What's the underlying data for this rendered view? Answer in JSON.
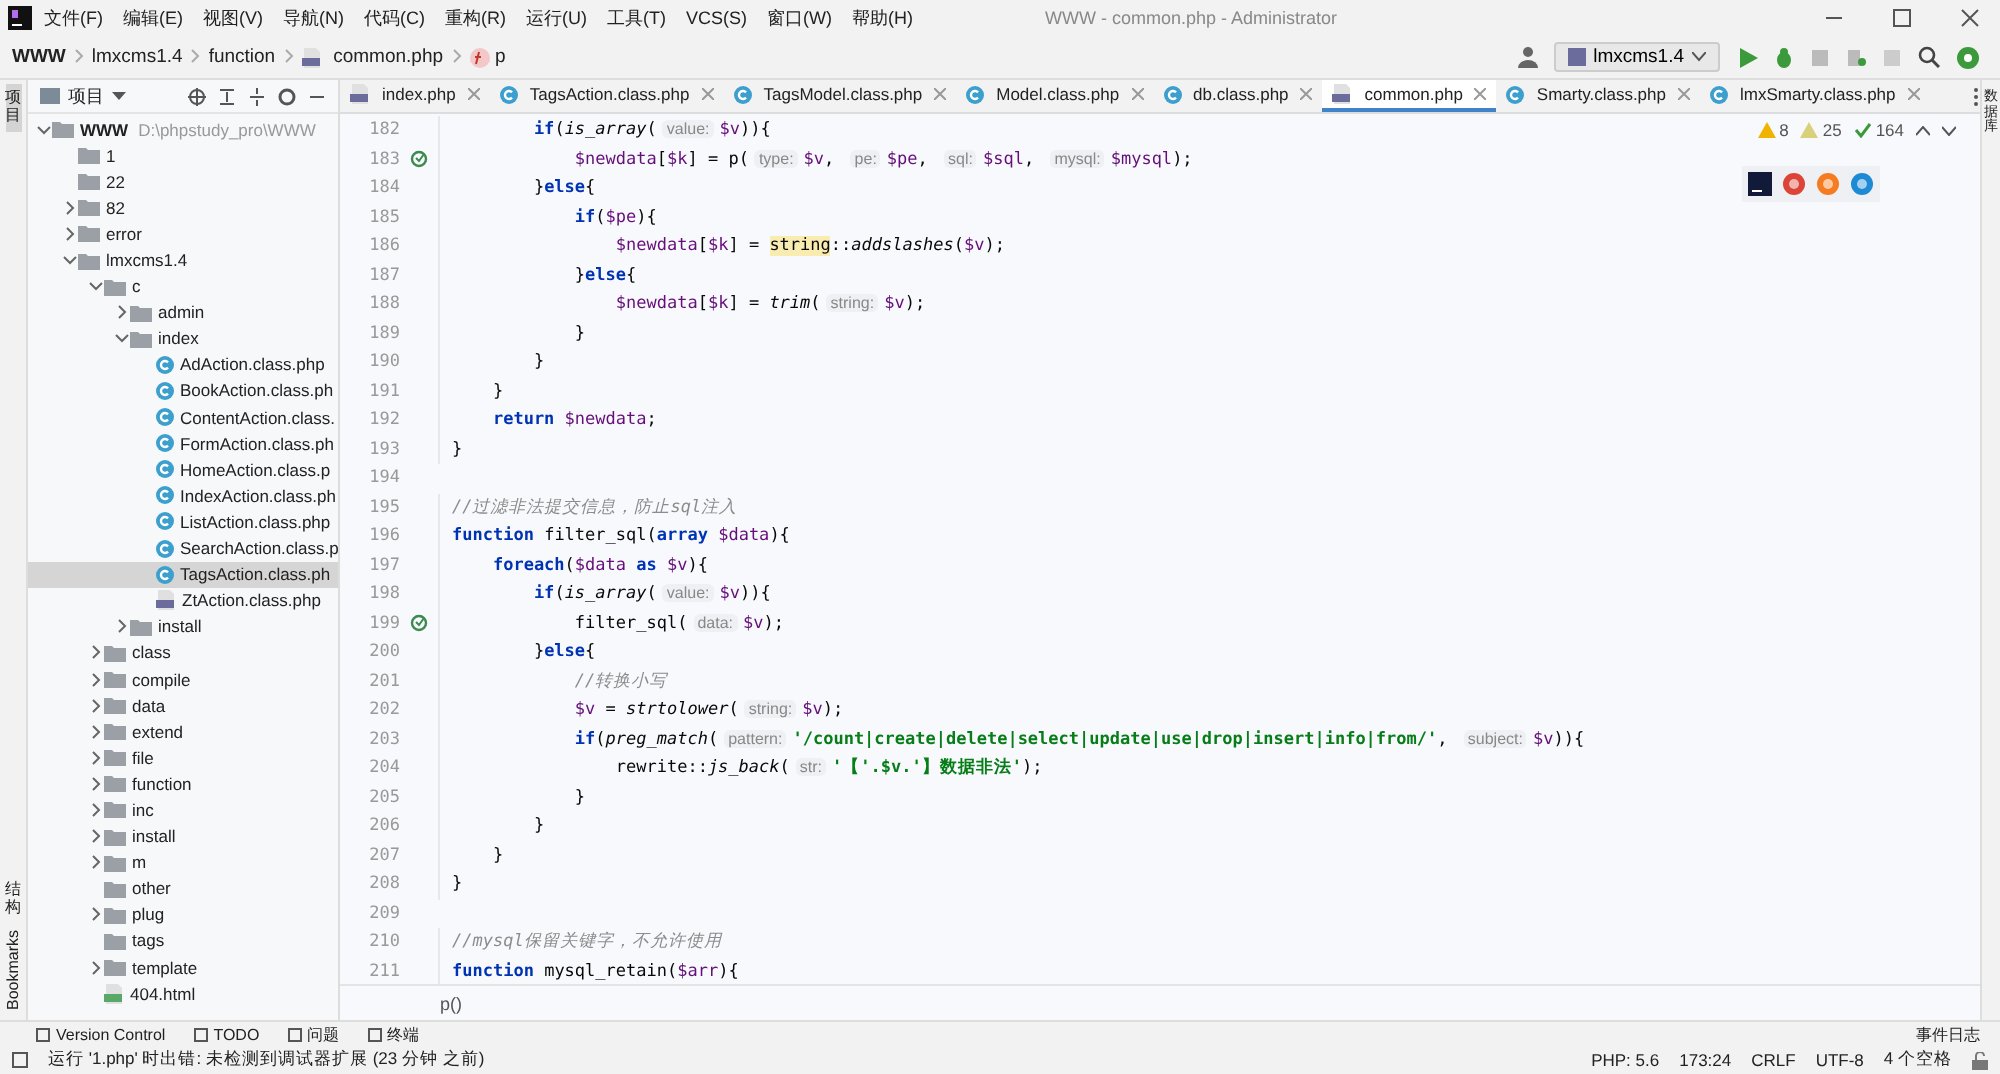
{
  "window": {
    "title": "WWW - common.php - Administrator"
  },
  "menu": [
    "文件(F)",
    "编辑(E)",
    "视图(V)",
    "导航(N)",
    "代码(C)",
    "重构(R)",
    "运行(U)",
    "工具(T)",
    "VCS(S)",
    "窗口(W)",
    "帮助(H)"
  ],
  "breadcrumb": [
    {
      "label": "WWW",
      "kind": "root"
    },
    {
      "label": "lmxcms1.4",
      "kind": "plain"
    },
    {
      "label": "function",
      "kind": "plain"
    },
    {
      "label": "common.php",
      "kind": "php"
    },
    {
      "label": "p",
      "kind": "function"
    }
  ],
  "run_config": "lmxcms1.4",
  "left_strip": [
    {
      "label": "项目",
      "kind": "cjk",
      "selected": true
    },
    {
      "label": "结构",
      "kind": "cjk",
      "selected": false
    },
    {
      "label": "Bookmarks",
      "kind": "latin",
      "selected": false
    }
  ],
  "right_strip": [
    {
      "label": "数据库",
      "kind": "cjk"
    }
  ],
  "project_panel": {
    "title": "项目"
  },
  "tree": [
    {
      "name": "WWW",
      "path": "D:\\phpstudy_pro\\WWW",
      "kind": "folder",
      "expanded": true,
      "selected": false,
      "children": [
        {
          "name": "1",
          "kind": "folder",
          "selected": false
        },
        {
          "name": "22",
          "kind": "folder",
          "selected": false
        },
        {
          "name": "82",
          "kind": "folder",
          "expanded": false,
          "selected": false
        },
        {
          "name": "error",
          "kind": "folder",
          "expanded": false,
          "selected": false
        },
        {
          "name": "lmxcms1.4",
          "kind": "folder",
          "expanded": true,
          "selected": false,
          "children": [
            {
              "name": "c",
              "kind": "folder",
              "expanded": true,
              "selected": false,
              "children": [
                {
                  "name": "admin",
                  "kind": "folder",
                  "expanded": false,
                  "selected": false
                },
                {
                  "name": "index",
                  "kind": "folder",
                  "expanded": true,
                  "selected": false,
                  "children": [
                    {
                      "name": "AdAction.class.php",
                      "kind": "class",
                      "selected": false
                    },
                    {
                      "name": "BookAction.class.ph",
                      "kind": "class",
                      "selected": false
                    },
                    {
                      "name": "ContentAction.class.",
                      "kind": "class",
                      "selected": false
                    },
                    {
                      "name": "FormAction.class.ph",
                      "kind": "class",
                      "selected": false
                    },
                    {
                      "name": "HomeAction.class.p",
                      "kind": "class",
                      "selected": false
                    },
                    {
                      "name": "IndexAction.class.ph",
                      "kind": "class",
                      "selected": false
                    },
                    {
                      "name": "ListAction.class.php",
                      "kind": "class",
                      "selected": false
                    },
                    {
                      "name": "SearchAction.class.p",
                      "kind": "class",
                      "selected": false
                    },
                    {
                      "name": "TagsAction.class.ph",
                      "kind": "class",
                      "selected": true
                    },
                    {
                      "name": "ZtAction.class.php",
                      "kind": "php",
                      "selected": false
                    }
                  ]
                },
                {
                  "name": "install",
                  "kind": "folder",
                  "expanded": false,
                  "selected": false
                }
              ]
            },
            {
              "name": "class",
              "kind": "folder",
              "expanded": false,
              "selected": false
            },
            {
              "name": "compile",
              "kind": "folder",
              "expanded": false,
              "selected": false
            },
            {
              "name": "data",
              "kind": "folder",
              "expanded": false,
              "selected": false
            },
            {
              "name": "extend",
              "kind": "folder",
              "expanded": false,
              "selected": false
            },
            {
              "name": "file",
              "kind": "folder",
              "expanded": false,
              "selected": false
            },
            {
              "name": "function",
              "kind": "folder",
              "expanded": false,
              "selected": false
            },
            {
              "name": "inc",
              "kind": "folder",
              "expanded": false,
              "selected": false
            },
            {
              "name": "install",
              "kind": "folder",
              "expanded": false,
              "selected": false
            },
            {
              "name": "m",
              "kind": "folder",
              "expanded": false,
              "selected": false
            },
            {
              "name": "other",
              "kind": "folder",
              "selected": false
            },
            {
              "name": "plug",
              "kind": "folder",
              "expanded": false,
              "selected": false
            },
            {
              "name": "tags",
              "kind": "folder",
              "selected": false
            },
            {
              "name": "template",
              "kind": "folder",
              "expanded": false,
              "selected": false
            },
            {
              "name": "404.html",
              "kind": "html",
              "selected": false
            }
          ]
        }
      ]
    }
  ],
  "tabs": [
    {
      "label": "index.php",
      "kind": "php",
      "selected": false
    },
    {
      "label": "TagsAction.class.php",
      "kind": "class",
      "selected": false
    },
    {
      "label": "TagsModel.class.php",
      "kind": "class",
      "selected": false
    },
    {
      "label": "Model.class.php",
      "kind": "class",
      "selected": false
    },
    {
      "label": "db.class.php",
      "kind": "class",
      "selected": false
    },
    {
      "label": "common.php",
      "kind": "php",
      "selected": true
    },
    {
      "label": "Smarty.class.php",
      "kind": "class",
      "selected": false
    },
    {
      "label": "lmxSmarty.class.php",
      "kind": "class",
      "selected": false
    }
  ],
  "inspections": [
    {
      "kind": "warning",
      "count": "8"
    },
    {
      "kind": "weak-warning",
      "count": "25"
    },
    {
      "kind": "typo",
      "count": "164"
    }
  ],
  "code": [
    {
      "n": "182",
      "tokens": [
        {
          "kind": "keyword",
          "text": "        if"
        },
        {
          "kind": "plain",
          "text": "("
        },
        {
          "kind": "function",
          "text": "is_array"
        },
        {
          "kind": "plain",
          "text": "("
        },
        {
          "kind": "hint",
          "text": "value:"
        },
        {
          "kind": "variable",
          "text": "$v"
        },
        {
          "kind": "plain",
          "text": ")){"
        }
      ]
    },
    {
      "n": "183",
      "recursive": true,
      "tokens": [
        {
          "kind": "variable",
          "text": "            $newdata"
        },
        {
          "kind": "plain",
          "text": "["
        },
        {
          "kind": "variable",
          "text": "$k"
        },
        {
          "kind": "plain",
          "text": "] = p("
        },
        {
          "kind": "hint",
          "text": "type:"
        },
        {
          "kind": "variable",
          "text": "$v"
        },
        {
          "kind": "plain",
          "text": ", "
        },
        {
          "kind": "hint",
          "text": "pe:"
        },
        {
          "kind": "variable",
          "text": "$pe"
        },
        {
          "kind": "plain",
          "text": ", "
        },
        {
          "kind": "hint",
          "text": "sql:"
        },
        {
          "kind": "variable",
          "text": "$sql"
        },
        {
          "kind": "plain",
          "text": ", "
        },
        {
          "kind": "hint",
          "text": "mysql:"
        },
        {
          "kind": "variable",
          "text": "$mysql"
        },
        {
          "kind": "plain",
          "text": ");"
        }
      ]
    },
    {
      "n": "184",
      "tokens": [
        {
          "kind": "plain",
          "text": "        }"
        },
        {
          "kind": "keyword",
          "text": "else"
        },
        {
          "kind": "plain",
          "text": "{"
        }
      ]
    },
    {
      "n": "185",
      "tokens": [
        {
          "kind": "keyword",
          "text": "            if"
        },
        {
          "kind": "plain",
          "text": "("
        },
        {
          "kind": "variable",
          "text": "$pe"
        },
        {
          "kind": "plain",
          "text": "){"
        }
      ]
    },
    {
      "n": "186",
      "tokens": [
        {
          "kind": "variable",
          "text": "                $newdata"
        },
        {
          "kind": "plain",
          "text": "["
        },
        {
          "kind": "variable",
          "text": "$k"
        },
        {
          "kind": "plain",
          "text": "] = "
        },
        {
          "kind": "class",
          "text": "string"
        },
        {
          "kind": "plain",
          "text": "::"
        },
        {
          "kind": "function",
          "text": "addslashes"
        },
        {
          "kind": "plain",
          "text": "("
        },
        {
          "kind": "variable",
          "text": "$v"
        },
        {
          "kind": "plain",
          "text": ");"
        }
      ]
    },
    {
      "n": "187",
      "tokens": [
        {
          "kind": "plain",
          "text": "            }"
        },
        {
          "kind": "keyword",
          "text": "else"
        },
        {
          "kind": "plain",
          "text": "{"
        }
      ]
    },
    {
      "n": "188",
      "tokens": [
        {
          "kind": "variable",
          "text": "                $newdata"
        },
        {
          "kind": "plain",
          "text": "["
        },
        {
          "kind": "variable",
          "text": "$k"
        },
        {
          "kind": "plain",
          "text": "] = "
        },
        {
          "kind": "function",
          "text": "trim"
        },
        {
          "kind": "plain",
          "text": "("
        },
        {
          "kind": "hint",
          "text": "string:"
        },
        {
          "kind": "variable",
          "text": "$v"
        },
        {
          "kind": "plain",
          "text": ");"
        }
      ]
    },
    {
      "n": "189",
      "tokens": [
        {
          "kind": "plain",
          "text": "            }"
        }
      ]
    },
    {
      "n": "190",
      "tokens": [
        {
          "kind": "plain",
          "text": "        }"
        }
      ]
    },
    {
      "n": "191",
      "tokens": [
        {
          "kind": "plain",
          "text": "    }"
        }
      ]
    },
    {
      "n": "192",
      "tokens": [
        {
          "kind": "keyword",
          "text": "    return"
        },
        {
          "kind": "variable",
          "text": " $newdata"
        },
        {
          "kind": "plain",
          "text": ";"
        }
      ]
    },
    {
      "n": "193",
      "tokens": [
        {
          "kind": "plain",
          "text": "}"
        }
      ]
    },
    {
      "n": "194"
    },
    {
      "n": "195",
      "tokens": [
        {
          "kind": "comment",
          "text": "//过滤非法提交信息，防止sql注入"
        }
      ]
    },
    {
      "n": "196",
      "tokens": [
        {
          "kind": "keyword",
          "text": "function"
        },
        {
          "kind": "plain",
          "text": " filter_sql("
        },
        {
          "kind": "keyword",
          "text": "array"
        },
        {
          "kind": "variable",
          "text": " $data"
        },
        {
          "kind": "plain",
          "text": "){"
        }
      ]
    },
    {
      "n": "197",
      "tokens": [
        {
          "kind": "keyword",
          "text": "    foreach"
        },
        {
          "kind": "plain",
          "text": "("
        },
        {
          "kind": "variable",
          "text": "$data"
        },
        {
          "kind": "keyword",
          "text": " as"
        },
        {
          "kind": "variable",
          "text": " $v"
        },
        {
          "kind": "plain",
          "text": "){"
        }
      ]
    },
    {
      "n": "198",
      "tokens": [
        {
          "kind": "keyword",
          "text": "        if"
        },
        {
          "kind": "plain",
          "text": "("
        },
        {
          "kind": "function",
          "text": "is_array"
        },
        {
          "kind": "plain",
          "text": "("
        },
        {
          "kind": "hint",
          "text": "value:"
        },
        {
          "kind": "variable",
          "text": "$v"
        },
        {
          "kind": "plain",
          "text": ")){"
        }
      ]
    },
    {
      "n": "199",
      "recursive": true,
      "tokens": [
        {
          "kind": "plain",
          "text": "            filter_sql("
        },
        {
          "kind": "hint",
          "text": "data:"
        },
        {
          "kind": "variable",
          "text": "$v"
        },
        {
          "kind": "plain",
          "text": ");"
        }
      ]
    },
    {
      "n": "200",
      "tokens": [
        {
          "kind": "plain",
          "text": "        }"
        },
        {
          "kind": "keyword",
          "text": "else"
        },
        {
          "kind": "plain",
          "text": "{"
        }
      ]
    },
    {
      "n": "201",
      "tokens": [
        {
          "kind": "comment",
          "text": "            //转换小写"
        }
      ]
    },
    {
      "n": "202",
      "tokens": [
        {
          "kind": "variable",
          "text": "            $v"
        },
        {
          "kind": "plain",
          "text": " = "
        },
        {
          "kind": "function",
          "text": "strtolower"
        },
        {
          "kind": "plain",
          "text": "("
        },
        {
          "kind": "hint",
          "text": "string:"
        },
        {
          "kind": "variable",
          "text": "$v"
        },
        {
          "kind": "plain",
          "text": ");"
        }
      ]
    },
    {
      "n": "203",
      "tokens": [
        {
          "kind": "keyword",
          "text": "            if"
        },
        {
          "kind": "plain",
          "text": "("
        },
        {
          "kind": "function",
          "text": "preg_match"
        },
        {
          "kind": "plain",
          "text": "("
        },
        {
          "kind": "hint",
          "text": "pattern:"
        },
        {
          "kind": "string",
          "text": "'/count|create|delete|select|update|use|drop|insert|info|from/'"
        },
        {
          "kind": "plain",
          "text": ", "
        },
        {
          "kind": "hint",
          "text": "subject:"
        },
        {
          "kind": "variable",
          "text": "$v"
        },
        {
          "kind": "plain",
          "text": ")){"
        }
      ]
    },
    {
      "n": "204",
      "tokens": [
        {
          "kind": "plain",
          "text": "                rewrite::"
        },
        {
          "kind": "function",
          "text": "js_back"
        },
        {
          "kind": "plain",
          "text": "("
        },
        {
          "kind": "hint",
          "text": "str:"
        },
        {
          "kind": "string",
          "text": "'【'.$v.'】数据非法'"
        },
        {
          "kind": "plain",
          "text": ");"
        }
      ]
    },
    {
      "n": "205",
      "tokens": [
        {
          "kind": "plain",
          "text": "            }"
        }
      ]
    },
    {
      "n": "206",
      "tokens": [
        {
          "kind": "plain",
          "text": "        }"
        }
      ]
    },
    {
      "n": "207",
      "tokens": [
        {
          "kind": "plain",
          "text": "    }"
        }
      ]
    },
    {
      "n": "208",
      "tokens": [
        {
          "kind": "plain",
          "text": "}"
        }
      ]
    },
    {
      "n": "209"
    },
    {
      "n": "210",
      "tokens": [
        {
          "kind": "comment",
          "text": "//mysql保留关键字，不允许使用"
        }
      ]
    },
    {
      "n": "211",
      "tokens": [
        {
          "kind": "keyword",
          "text": "function"
        },
        {
          "kind": "plain",
          "text": " mysql_retain("
        },
        {
          "kind": "variable",
          "text": "$arr"
        },
        {
          "kind": "plain",
          "text": "){"
        }
      ]
    }
  ],
  "editor_breadcrumb": "p()",
  "tool_tabs": [
    "Version Control",
    "TODO",
    "问题",
    "终端"
  ],
  "event_log": "事件日志",
  "status_bar": {
    "message": "运行 '1.php' 时出错: 未检测到调试器扩展 (23 分钟 之前)",
    "items": [
      "PHP: 5.6",
      "173:24",
      "CRLF",
      "UTF-8",
      "4 个空格"
    ]
  }
}
